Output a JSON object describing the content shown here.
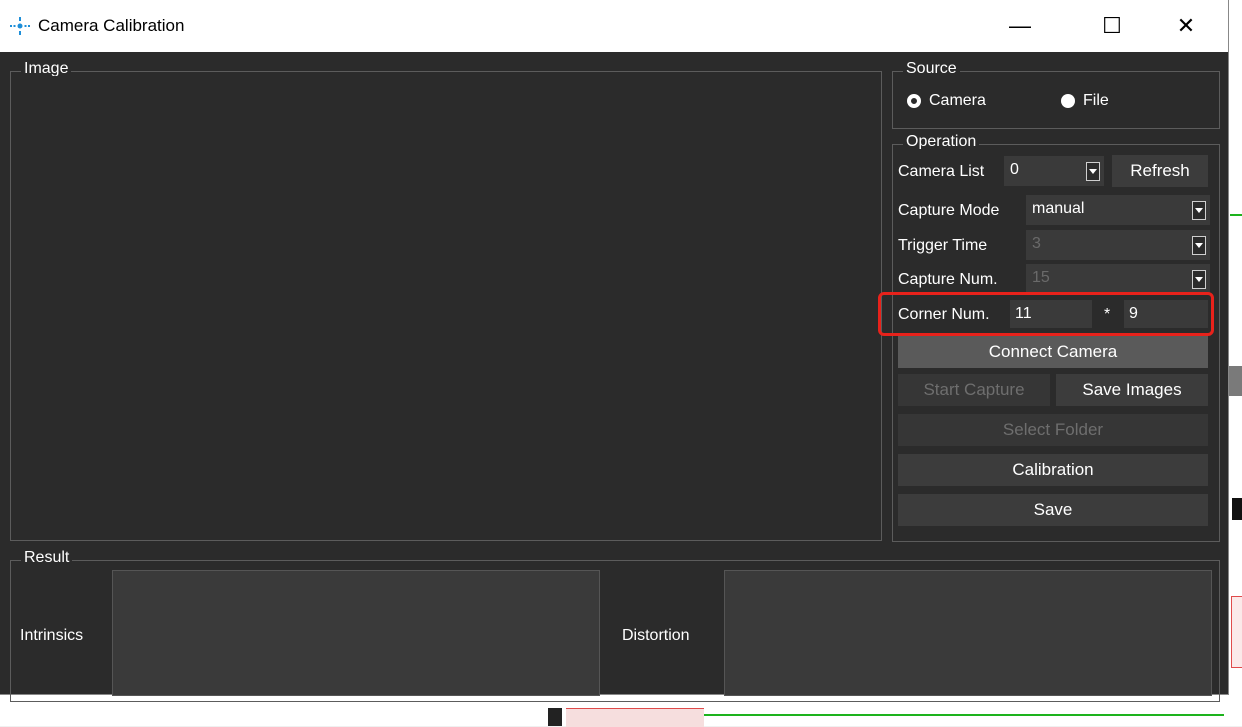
{
  "window": {
    "title": "Camera Calibration",
    "controls": {
      "minimize": "—",
      "maximize": "☐",
      "close": "✕"
    }
  },
  "image_group": {
    "title": "Image"
  },
  "source_group": {
    "title": "Source",
    "options": [
      {
        "label": "Camera",
        "selected": true
      },
      {
        "label": "File",
        "selected": false
      }
    ]
  },
  "operation_group": {
    "title": "Operation",
    "camera_list": {
      "label": "Camera List",
      "value": "0"
    },
    "refresh_button": "Refresh",
    "capture_mode": {
      "label": "Capture Mode",
      "value": "manual"
    },
    "trigger_time": {
      "label": "Trigger Time",
      "value": "3"
    },
    "capture_num": {
      "label": "Capture Num.",
      "value": "15"
    },
    "corner_num": {
      "label": "Corner Num.",
      "cols": "11",
      "separator": "*",
      "rows": "9"
    },
    "buttons": {
      "connect_camera": "Connect Camera",
      "start_capture": "Start Capture",
      "save_images": "Save Images",
      "select_folder": "Select Folder",
      "calibration": "Calibration",
      "save": "Save"
    }
  },
  "result_group": {
    "title": "Result",
    "intrinsics_label": "Intrinsics",
    "distortion_label": "Distortion"
  },
  "colors": {
    "window_bg": "#2b2b2b",
    "control_bg": "#3a3a3a",
    "highlight": "#e8221b",
    "accent_blue": "#1e8fd9"
  }
}
